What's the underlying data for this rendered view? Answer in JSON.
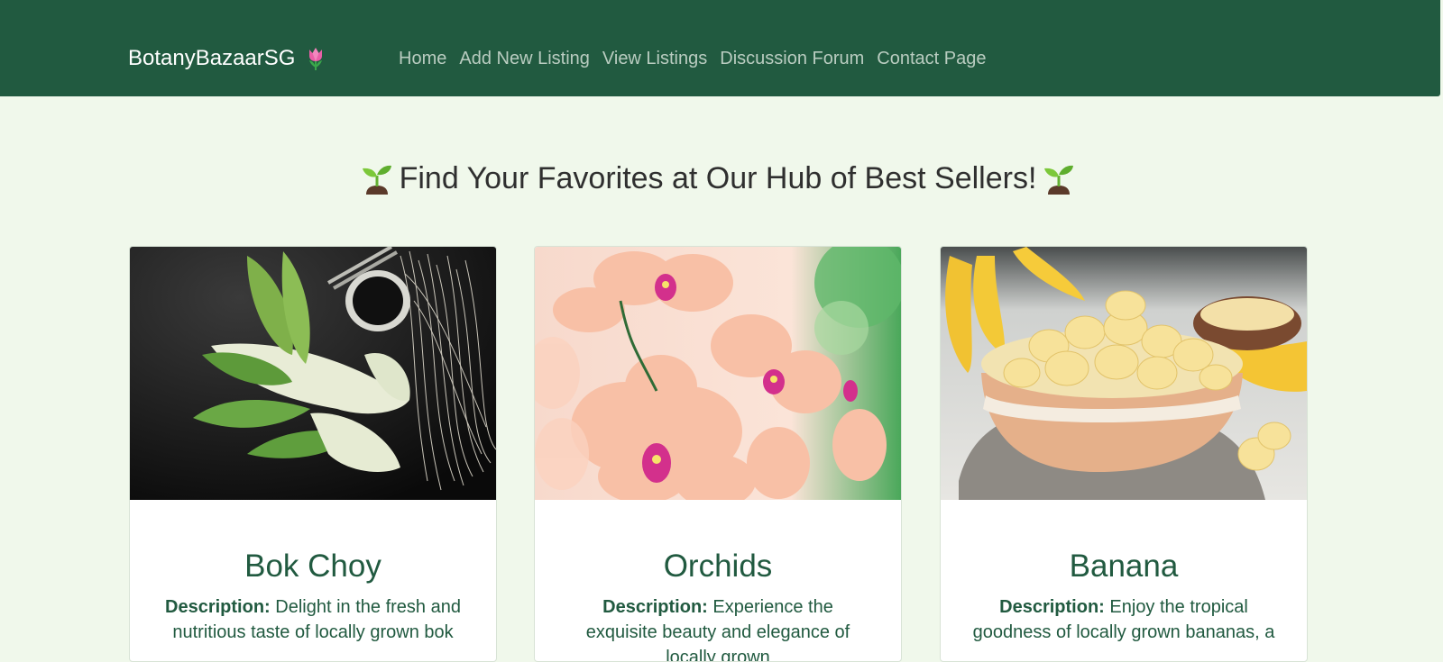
{
  "brand": {
    "name": "BotanyBazaarSG",
    "icon": "tulip-icon"
  },
  "nav": {
    "items": [
      {
        "label": "Home"
      },
      {
        "label": "Add New Listing"
      },
      {
        "label": "View Listings"
      },
      {
        "label": "Discussion Forum"
      },
      {
        "label": "Contact Page"
      }
    ]
  },
  "headline": {
    "text": "Find Your Favorites at Our Hub of Best Sellers!",
    "icon": "seedling-icon"
  },
  "cards": [
    {
      "title": "Bok Choy",
      "desc_label": "Description:",
      "desc_text": "Delight in the fresh and nutritious taste of locally grown bok",
      "image": "bok-choy-photo"
    },
    {
      "title": "Orchids",
      "desc_label": "Description:",
      "desc_text": "Experience the exquisite beauty and elegance of locally grown",
      "image": "orchids-photo"
    },
    {
      "title": "Banana",
      "desc_label": "Description:",
      "desc_text": "Enjoy the tropical goodness of locally grown bananas, a",
      "image": "banana-photo"
    }
  ],
  "colors": {
    "navbar": "#215a40",
    "page_bg": "#f0f8eb",
    "accent_text": "#215a40"
  }
}
